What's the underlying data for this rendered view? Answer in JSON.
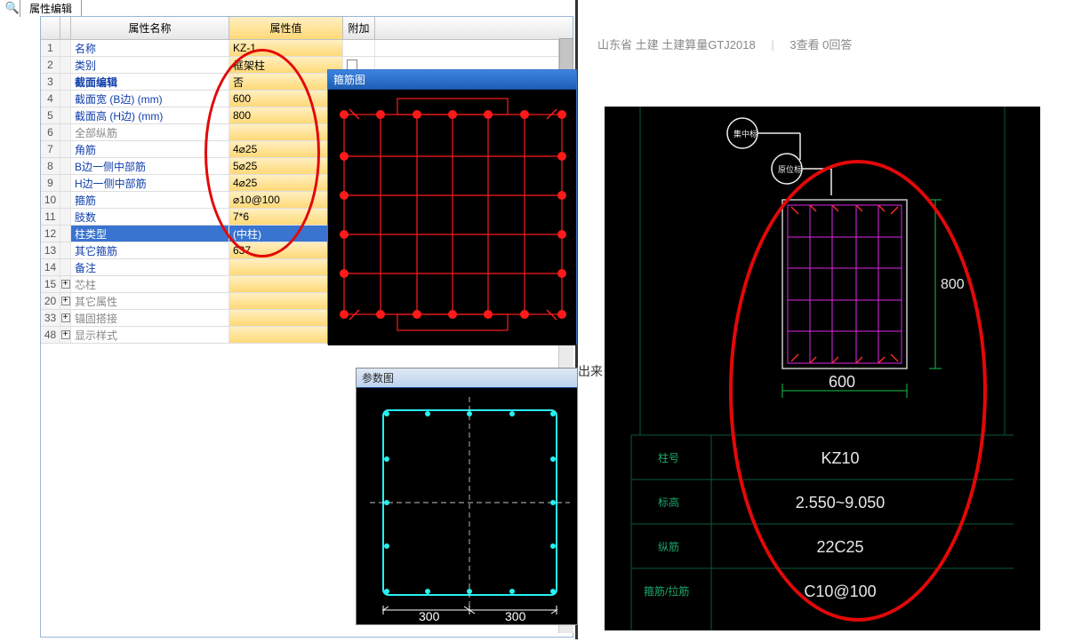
{
  "tab": {
    "label": "属性编辑"
  },
  "grid": {
    "headers": {
      "name": "属性名称",
      "value": "属性值",
      "extra": "附加"
    },
    "rows": [
      {
        "n": "1",
        "name": "名称",
        "val": "KZ-1"
      },
      {
        "n": "2",
        "name": "类别",
        "val": "框架柱",
        "chk": true
      },
      {
        "n": "3",
        "name": "截面编辑",
        "val": "否",
        "cls": "editgrp"
      },
      {
        "n": "4",
        "name": "截面宽 (B边) (mm)",
        "val": "600"
      },
      {
        "n": "5",
        "name": "截面高 (H边) (mm)",
        "val": "800"
      },
      {
        "n": "6",
        "name": "全部纵筋",
        "val": "",
        "cls": "muted"
      },
      {
        "n": "7",
        "name": "角筋",
        "val": "4⌀25"
      },
      {
        "n": "8",
        "name": "B边一侧中部筋",
        "val": "5⌀25"
      },
      {
        "n": "9",
        "name": "H边一侧中部筋",
        "val": "4⌀25"
      },
      {
        "n": "10",
        "name": "箍筋",
        "val": "⌀10@100"
      },
      {
        "n": "11",
        "name": "肢数",
        "val": "7*6"
      },
      {
        "n": "12",
        "name": "柱类型",
        "val": "(中柱)",
        "cls": "selected"
      },
      {
        "n": "13",
        "name": "其它箍筋",
        "val": "637"
      },
      {
        "n": "14",
        "name": "备注",
        "val": ""
      },
      {
        "n": "15",
        "name": "芯柱",
        "val": "",
        "exp": true,
        "cls": "muted"
      },
      {
        "n": "20",
        "name": "其它属性",
        "val": "",
        "exp": true,
        "cls": "muted"
      },
      {
        "n": "33",
        "name": "锚固搭接",
        "val": "",
        "exp": true,
        "cls": "muted"
      },
      {
        "n": "48",
        "name": "显示样式",
        "val": "",
        "exp": true,
        "cls": "muted"
      }
    ]
  },
  "dialog1": {
    "title": "箍筋图"
  },
  "dialog2": {
    "title": "参数图",
    "dim_half": "300"
  },
  "side_info": {
    "breadcrumb": "山东省  土建 土建算量GTJ2018",
    "stats": "3查看  0回答",
    "partial": "出来"
  },
  "cad": {
    "tags": {
      "a": "集中标",
      "b": "原位标"
    },
    "width_dim": "600",
    "height_dim": "800",
    "rows": [
      {
        "k": "柱号",
        "v": "KZ10"
      },
      {
        "k": "标高",
        "v": "2.550~9.050"
      },
      {
        "k": "纵筋",
        "v": "22C25"
      },
      {
        "k": "箍筋/拉筋",
        "v": "C10@100"
      }
    ]
  }
}
